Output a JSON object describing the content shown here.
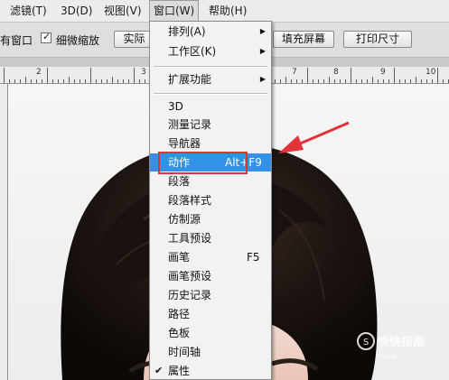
{
  "menubar": {
    "items": [
      {
        "label": "滤镜(T)"
      },
      {
        "label": "3D(D)"
      },
      {
        "label": "视图(V)"
      },
      {
        "label": "窗口(W)"
      },
      {
        "label": "帮助(H)"
      }
    ]
  },
  "options": {
    "partial_text": "有窗口",
    "scrubby_zoom_label": "细微缩放",
    "scrubby_zoom_checked": true,
    "actual_pixels_label": "实际",
    "fit_screen_partial": "",
    "fill_screen_label": "填充屏幕",
    "print_size_label": "打印尺寸"
  },
  "ruler": {
    "labels": [
      "2",
      "3",
      "7",
      "8",
      "9",
      "10"
    ]
  },
  "window_menu": {
    "items": [
      {
        "label": "排列(A)",
        "submenu": true
      },
      {
        "label": "工作区(K)",
        "submenu": true
      },
      {
        "label": "扩展功能",
        "submenu": true
      },
      {
        "label": "3D"
      },
      {
        "label": "测量记录"
      },
      {
        "label": "导航器"
      },
      {
        "label": "动作",
        "shortcut": "Alt+F9",
        "highlighted": true
      },
      {
        "label": "段落"
      },
      {
        "label": "段落样式"
      },
      {
        "label": "仿制源"
      },
      {
        "label": "工具预设"
      },
      {
        "label": "画笔",
        "shortcut": "F5"
      },
      {
        "label": "画笔预设"
      },
      {
        "label": "历史记录"
      },
      {
        "label": "路径"
      },
      {
        "label": "色板"
      },
      {
        "label": "时间轴"
      },
      {
        "label": "属性",
        "checked": true
      }
    ]
  },
  "icons": {
    "submenu_arrow": "triangle-right-icon",
    "check": "checkmark-icon",
    "annotation_arrow": "red-arrow-icon"
  },
  "colors": {
    "highlight": "#3392e8",
    "annotation": "#e2323a"
  },
  "watermark": {
    "brand": "快快指南",
    "domain": "zhinan..."
  }
}
